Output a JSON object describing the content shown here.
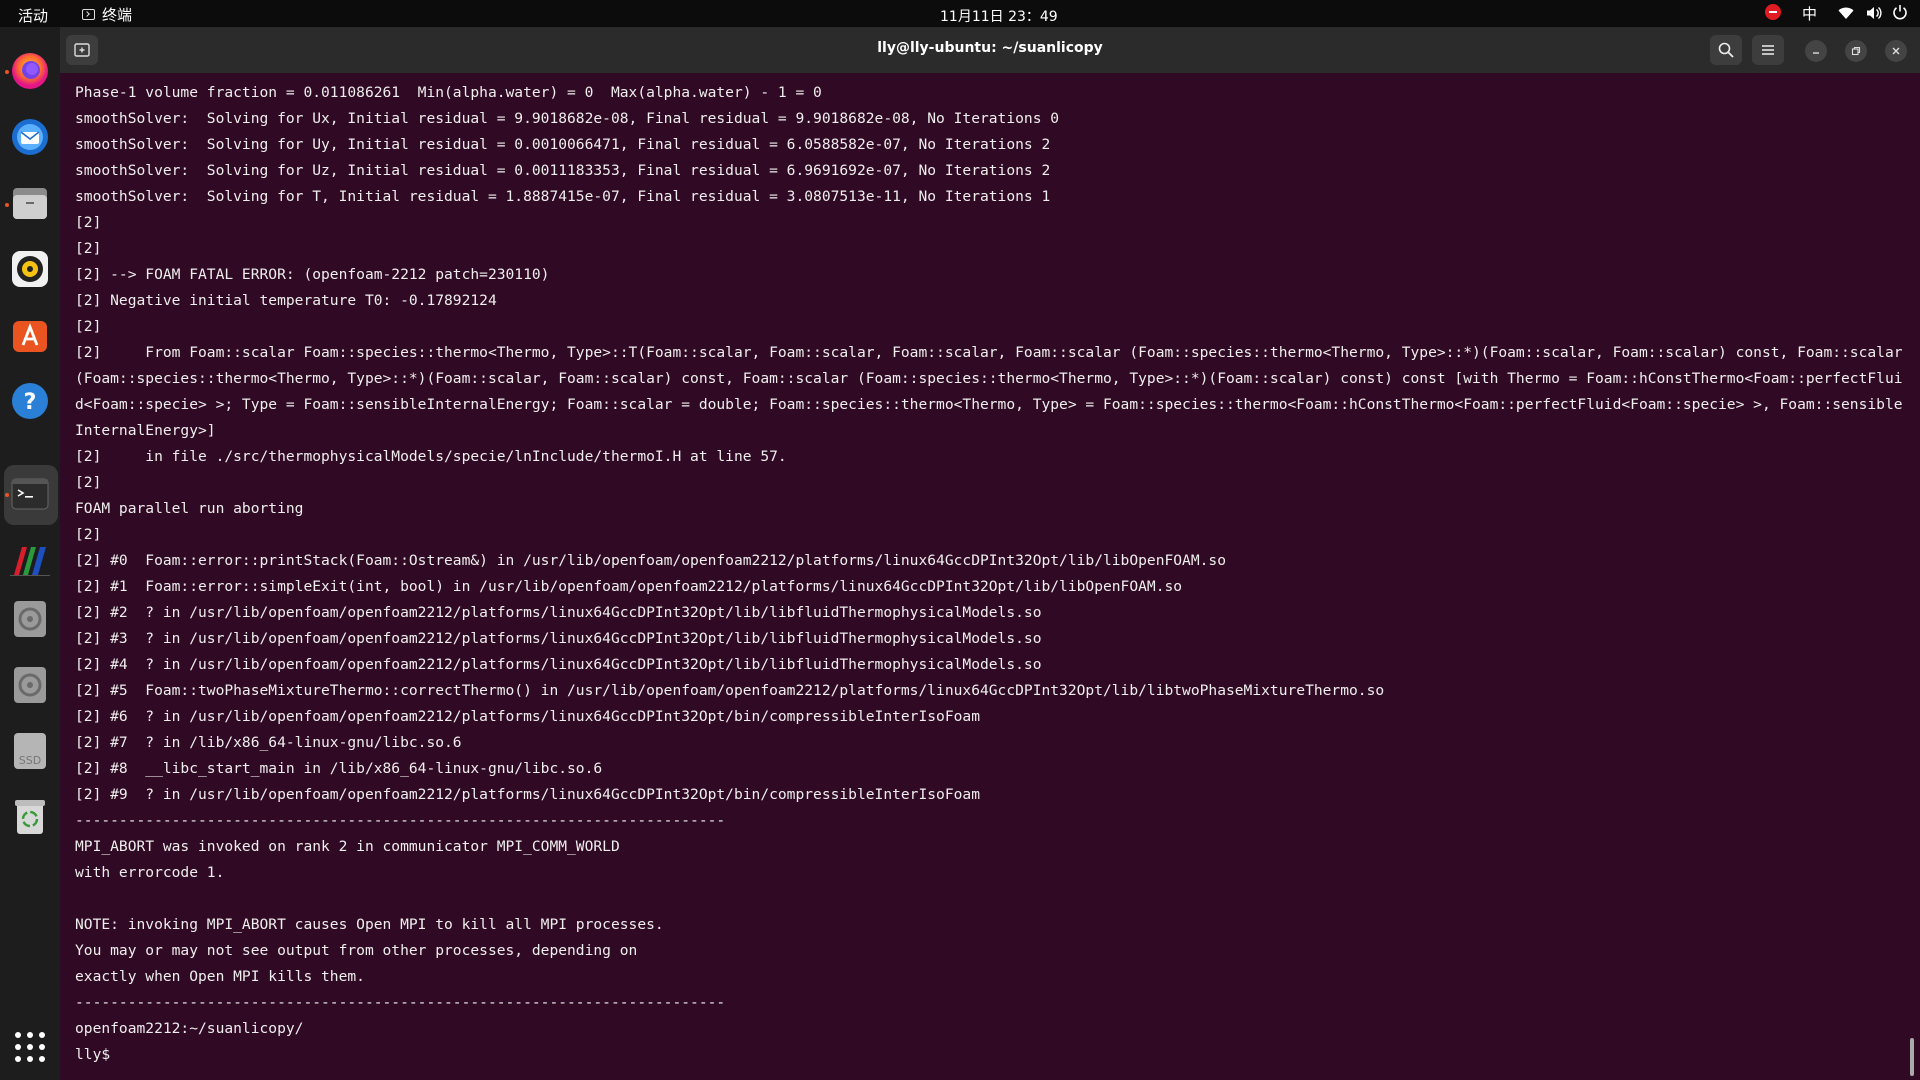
{
  "topbar": {
    "activities": "活动",
    "app_name": "终端",
    "clock": "11月11日  23：49",
    "ime": "中"
  },
  "dock": {
    "items": [
      {
        "icon": "firefox-icon",
        "running": true
      },
      {
        "icon": "thunderbird-icon",
        "running": false
      },
      {
        "icon": "files-icon",
        "running": true
      },
      {
        "icon": "rhythmbox-icon",
        "running": false
      },
      {
        "icon": "app-center-icon",
        "running": false
      },
      {
        "icon": "help-icon",
        "running": false
      },
      {
        "icon": "terminal-icon",
        "running": true,
        "active": true
      },
      {
        "icon": "paraview-icon",
        "running": false
      },
      {
        "icon": "disk-icon",
        "running": false
      },
      {
        "icon": "disk-icon",
        "running": false
      },
      {
        "icon": "ssd-icon",
        "running": false
      },
      {
        "icon": "trash-icon",
        "running": false
      }
    ],
    "ssd_label": "SSD"
  },
  "window": {
    "title": "lly@lly-ubuntu: ~/suanlicopy"
  },
  "terminal": {
    "lines": [
      "Phase-1 volume fraction = 0.011086261  Min(alpha.water) = 0  Max(alpha.water) - 1 = 0",
      "smoothSolver:  Solving for Ux, Initial residual = 9.9018682e-08, Final residual = 9.9018682e-08, No Iterations 0",
      "smoothSolver:  Solving for Uy, Initial residual = 0.0010066471, Final residual = 6.0588582e-07, No Iterations 2",
      "smoothSolver:  Solving for Uz, Initial residual = 0.0011183353, Final residual = 6.9691692e-07, No Iterations 2",
      "smoothSolver:  Solving for T, Initial residual = 1.8887415e-07, Final residual = 3.0807513e-11, No Iterations 1",
      "[2]",
      "[2]",
      "[2] --> FOAM FATAL ERROR: (openfoam-2212 patch=230110)",
      "[2] Negative initial temperature T0: -0.17892124",
      "[2]",
      "[2]     From Foam::scalar Foam::species::thermo<Thermo, Type>::T(Foam::scalar, Foam::scalar, Foam::scalar, Foam::scalar (Foam::species::thermo<Thermo, Type>::*)(Foam::scalar, Foam::scalar) const, Foam::scalar (Foam::species::thermo<Thermo, Type>::*)(Foam::scalar, Foam::scalar) const, Foam::scalar (Foam::species::thermo<Thermo, Type>::*)(Foam::scalar) const) const [with Thermo = Foam::hConstThermo<Foam::perfectFluid<Foam::specie> >; Type = Foam::sensibleInternalEnergy; Foam::scalar = double; Foam::species::thermo<Thermo, Type> = Foam::species::thermo<Foam::hConstThermo<Foam::perfectFluid<Foam::specie> >, Foam::sensibleInternalEnergy>]",
      "[2]     in file ./src/thermophysicalModels/specie/lnInclude/thermoI.H at line 57.",
      "[2]",
      "FOAM parallel run aborting",
      "[2]",
      "[2] #0  Foam::error::printStack(Foam::Ostream&) in /usr/lib/openfoam/openfoam2212/platforms/linux64GccDPInt32Opt/lib/libOpenFOAM.so",
      "[2] #1  Foam::error::simpleExit(int, bool) in /usr/lib/openfoam/openfoam2212/platforms/linux64GccDPInt32Opt/lib/libOpenFOAM.so",
      "[2] #2  ? in /usr/lib/openfoam/openfoam2212/platforms/linux64GccDPInt32Opt/lib/libfluidThermophysicalModels.so",
      "[2] #3  ? in /usr/lib/openfoam/openfoam2212/platforms/linux64GccDPInt32Opt/lib/libfluidThermophysicalModels.so",
      "[2] #4  ? in /usr/lib/openfoam/openfoam2212/platforms/linux64GccDPInt32Opt/lib/libfluidThermophysicalModels.so",
      "[2] #5  Foam::twoPhaseMixtureThermo::correctThermo() in /usr/lib/openfoam/openfoam2212/platforms/linux64GccDPInt32Opt/lib/libtwoPhaseMixtureThermo.so",
      "[2] #6  ? in /usr/lib/openfoam/openfoam2212/platforms/linux64GccDPInt32Opt/bin/compressibleInterIsoFoam",
      "[2] #7  ? in /lib/x86_64-linux-gnu/libc.so.6",
      "[2] #8  __libc_start_main in /lib/x86_64-linux-gnu/libc.so.6",
      "[2] #9  ? in /usr/lib/openfoam/openfoam2212/platforms/linux64GccDPInt32Opt/bin/compressibleInterIsoFoam",
      "--------------------------------------------------------------------------",
      "MPI_ABORT was invoked on rank 2 in communicator MPI_COMM_WORLD",
      "with errorcode 1.",
      "",
      "NOTE: invoking MPI_ABORT causes Open MPI to kill all MPI processes.",
      "You may or may not see output from other processes, depending on",
      "exactly when Open MPI kills them.",
      "--------------------------------------------------------------------------",
      "openfoam2212:~/suanlicopy/",
      "lly$"
    ]
  },
  "colors": {
    "terminal_bg": "#300a24",
    "terminal_fg": "#eeeeec",
    "accent": "#e95420"
  }
}
